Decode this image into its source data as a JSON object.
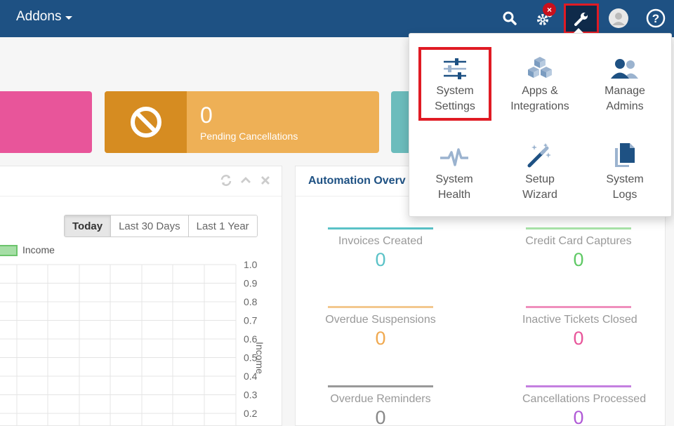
{
  "nav": {
    "addons_label": "Addons",
    "notification_badge": "×"
  },
  "cards": {
    "pending": {
      "value": "0",
      "label": "Pending Cancellations"
    }
  },
  "chart_panel": {
    "ranges": [
      "Today",
      "Last 30 Days",
      "Last 1 Year"
    ],
    "active_range": "Today"
  },
  "chart_data": {
    "type": "bar",
    "series": [
      {
        "name": "Income",
        "values": []
      }
    ],
    "ylabel": "Income",
    "ylim": [
      0,
      1
    ],
    "yticks": [
      "1.0",
      "0.9",
      "0.8",
      "0.7",
      "0.6",
      "0.5",
      "0.4",
      "0.3",
      "0.2"
    ],
    "grid": true
  },
  "automation": {
    "title": "Automation Overv",
    "stats": [
      {
        "label": "Invoices Created",
        "value": "0",
        "color": "#5ac2c7"
      },
      {
        "label": "Credit Card Captures",
        "value": "0",
        "color": "#5fc965"
      },
      {
        "label": "Overdue Suspensions",
        "value": "0",
        "color": "#f0a950"
      },
      {
        "label": "Inactive Tickets Closed",
        "value": "0",
        "color": "#e8559a"
      },
      {
        "label": "Overdue Reminders",
        "value": "0",
        "color": "#999999"
      },
      {
        "label": "Cancellations Processed",
        "value": "0",
        "color": "#b05ad6"
      }
    ]
  },
  "dropdown": {
    "items": [
      {
        "label": "System\nSettings",
        "icon": "sliders-icon"
      },
      {
        "label": "Apps &\nIntegrations",
        "icon": "cubes-icon"
      },
      {
        "label": "Manage\nAdmins",
        "icon": "users-icon"
      },
      {
        "label": "System\nHealth",
        "icon": "heartbeat-icon"
      },
      {
        "label": "Setup\nWizard",
        "icon": "magic-wand-icon"
      },
      {
        "label": "System\nLogs",
        "icon": "files-icon"
      }
    ]
  },
  "colors": {
    "nav": "#1e5183",
    "highlight": "#e01b24",
    "icon_blue": "#9bb3cf",
    "icon_dark": "#1e5183"
  }
}
